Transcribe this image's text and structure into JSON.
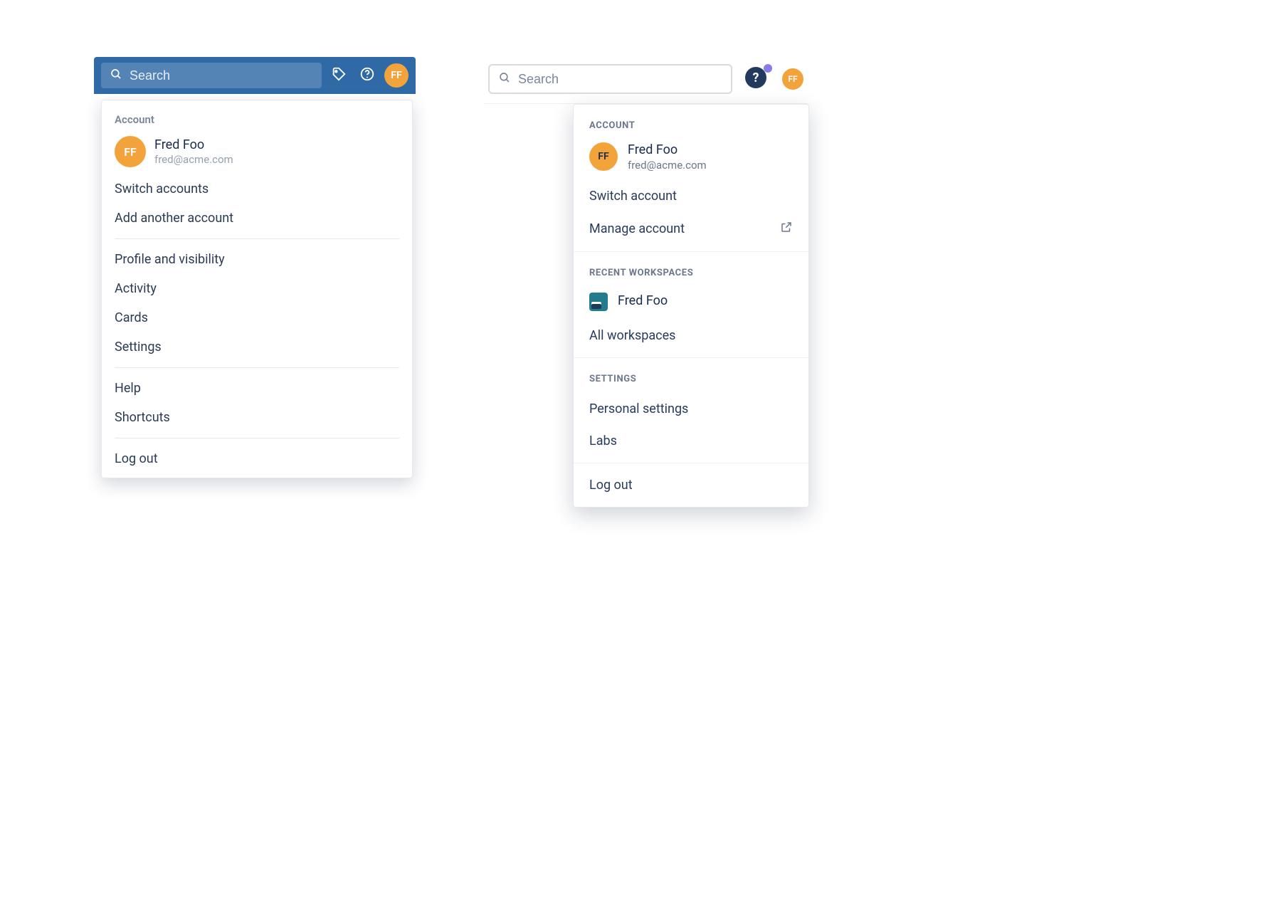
{
  "left": {
    "search_placeholder": "Search",
    "avatar_initials": "FF",
    "menu": {
      "account_heading": "Account",
      "user_name": "Fred Foo",
      "user_email": "fred@acme.com",
      "avatar_initials": "FF",
      "switch_accounts": "Switch accounts",
      "add_another": "Add another account",
      "profile_visibility": "Profile and visibility",
      "activity": "Activity",
      "cards": "Cards",
      "settings": "Settings",
      "help": "Help",
      "shortcuts": "Shortcuts",
      "logout": "Log out"
    }
  },
  "right": {
    "search_placeholder": "Search",
    "avatar_initials": "FF",
    "help_glyph": "?",
    "menu": {
      "account_heading": "ACCOUNT",
      "user_name": "Fred Foo",
      "user_email": "fred@acme.com",
      "avatar_initials": "FF",
      "switch_account": "Switch account",
      "manage_account": "Manage account",
      "recent_heading": "RECENT WORKSPACES",
      "workspace_name": "Fred Foo",
      "all_workspaces": "All workspaces",
      "settings_heading": "SETTINGS",
      "personal_settings": "Personal settings",
      "labs": "Labs",
      "logout": "Log out"
    }
  }
}
